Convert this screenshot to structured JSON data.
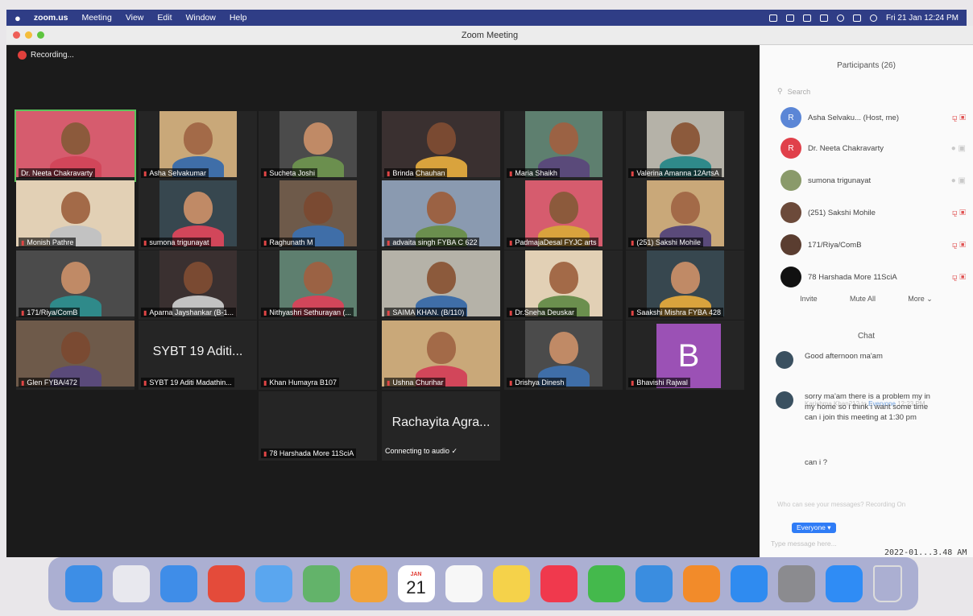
{
  "menubar": {
    "app": "zoom.us",
    "items": [
      "Meeting",
      "View",
      "Edit",
      "Window",
      "Help"
    ],
    "clock": "Fri 21 Jan  12:24 PM"
  },
  "window": {
    "title": "Zoom Meeting",
    "recording": "Recording..."
  },
  "tiles": [
    {
      "name": "Dr. Neeta Chakravarty",
      "active": true
    },
    {
      "name": "Asha Selvakumar"
    },
    {
      "name": "Sucheta Joshi"
    },
    {
      "name": "Brinda Chauhan"
    },
    {
      "name": "Maria Shaikh"
    },
    {
      "name": "Valerina Amanna 12ArtsA"
    },
    {
      "name": "Monish Pathre"
    },
    {
      "name": "sumona trigunayat"
    },
    {
      "name": "Raghunath M"
    },
    {
      "name": "advaita singh FYBA C 622"
    },
    {
      "name": "PadmajaDesal FYJC arts"
    },
    {
      "name": "(251) Sakshi Mohile"
    },
    {
      "name": "171/Riya/ComB"
    },
    {
      "name": "Aparna Jayshankar (B-1..."
    },
    {
      "name": "Nithyashri Sethurayan (..."
    },
    {
      "name": "SAIMA KHAN. (B/110)"
    },
    {
      "name": "Dr.Sneha Deuskar"
    },
    {
      "name": "Saakshi Mishra FYBA 428"
    },
    {
      "name": "Glen FYBA/472"
    },
    {
      "name": "SYBT 19 Aditi Madathin...",
      "big": "SYBT 19 Aditi..."
    },
    {
      "name": "Khan Humayra B107"
    },
    {
      "name": "Ushna Churihar"
    },
    {
      "name": "Drishya Dinesh"
    },
    {
      "name": "Bhavishi Rajwal",
      "letter": "B"
    },
    {
      "name": "78 Harshada More 11SciA"
    },
    {
      "big": "Rachayita Agra...",
      "status": "Connecting to audio ✓"
    }
  ],
  "participants": {
    "title": "Participants (26)",
    "search_placeholder": "Search",
    "list": [
      {
        "name": "Asha Selvaku...  (Host, me)",
        "initial": "R"
      },
      {
        "name": "Dr. Neeta Chakravarty",
        "initial": "R"
      },
      {
        "name": "sumona trigunayat"
      },
      {
        "name": "(251) Sakshi Mohile"
      },
      {
        "name": "171/Riya/ComB"
      },
      {
        "name": "78 Harshada More 11SciA"
      }
    ],
    "actions": [
      "Invite",
      "Mute All",
      "More ⌄"
    ]
  },
  "chat": {
    "title": "Chat",
    "messages": [
      {
        "text": "Good afternoon ma'am"
      },
      {
        "text": "sorry ma'am there is a problem my in my home so i think i want some time can i join this meeting at 1:30 pm"
      },
      {
        "text": "can i ?"
      }
    ],
    "meta_from": "Karishma Khan212 to",
    "meta_to": "Everyone",
    "meta_time": "12:23 PM",
    "who_note": "Who can see your messages? Recording On",
    "send_to": "Everyone ▾",
    "input_placeholder": "Type message here..."
  },
  "timestamp": "2022-01...3.48 AM",
  "dock": {
    "apps": [
      {
        "icon": "finder-icon",
        "color": "#3d8ee6"
      },
      {
        "icon": "launchpad-icon",
        "color": "#e8e8ee"
      },
      {
        "icon": "safari-icon",
        "color": "#3f8de8"
      },
      {
        "icon": "chrome-icon",
        "color": "#e44b3a"
      },
      {
        "icon": "mail-icon",
        "color": "#5aa6ef"
      },
      {
        "icon": "maps-icon",
        "color": "#63b36a"
      },
      {
        "icon": "photos-icon",
        "color": "#f1a33b"
      },
      {
        "icon": "calendar-icon",
        "color": "#ffffff",
        "month": "JAN",
        "day": "21"
      },
      {
        "icon": "reminders-icon",
        "color": "#f7f7f7"
      },
      {
        "icon": "notes-icon",
        "color": "#f5d24a"
      },
      {
        "icon": "music-icon",
        "color": "#f0394d"
      },
      {
        "icon": "numbers-icon",
        "color": "#44b94c"
      },
      {
        "icon": "keynote-icon",
        "color": "#3a8de0"
      },
      {
        "icon": "pages-icon",
        "color": "#f28b2a"
      },
      {
        "icon": "appstore-icon",
        "color": "#2f8bf0"
      },
      {
        "icon": "settings-icon",
        "color": "#8b8b8f"
      },
      {
        "icon": "zoom-icon",
        "color": "#2f8cf5"
      },
      {
        "icon": "trash-icon",
        "color": "#dcdcdc"
      }
    ]
  }
}
